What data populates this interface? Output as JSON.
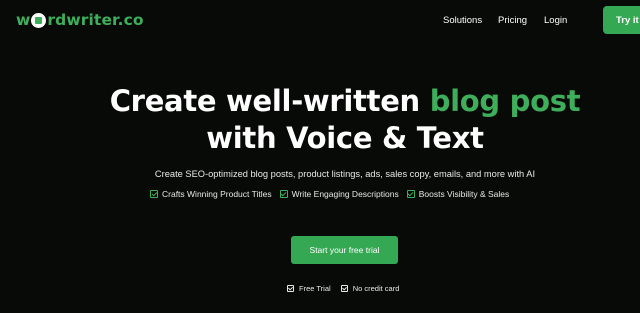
{
  "header": {
    "logo": {
      "prefix": "w",
      "suffix": "rdwriter.co"
    },
    "nav": [
      "Solutions",
      "Pricing",
      "Login"
    ],
    "cta_label": "Try it"
  },
  "hero": {
    "title_line1_plain": "Create well-written ",
    "title_line1_accent": "blog post",
    "title_line2": "with Voice & Text",
    "subtitle": "Create SEO-optimized blog posts, product listings, ads, sales copy, emails, and more with AI",
    "features": [
      "Crafts Winning Product Titles",
      "Write Engaging Descriptions",
      "Boosts Visibility & Sales"
    ],
    "cta_label": "Start your free trial",
    "footnotes": [
      "Free Trial",
      "No credit card"
    ]
  },
  "colors": {
    "background": "#070a07",
    "accent": "#34a853",
    "text": "#ffffff"
  },
  "icons": {
    "logo_mark": "pen-circle-icon",
    "feature_check": "checkbox-check-icon"
  }
}
